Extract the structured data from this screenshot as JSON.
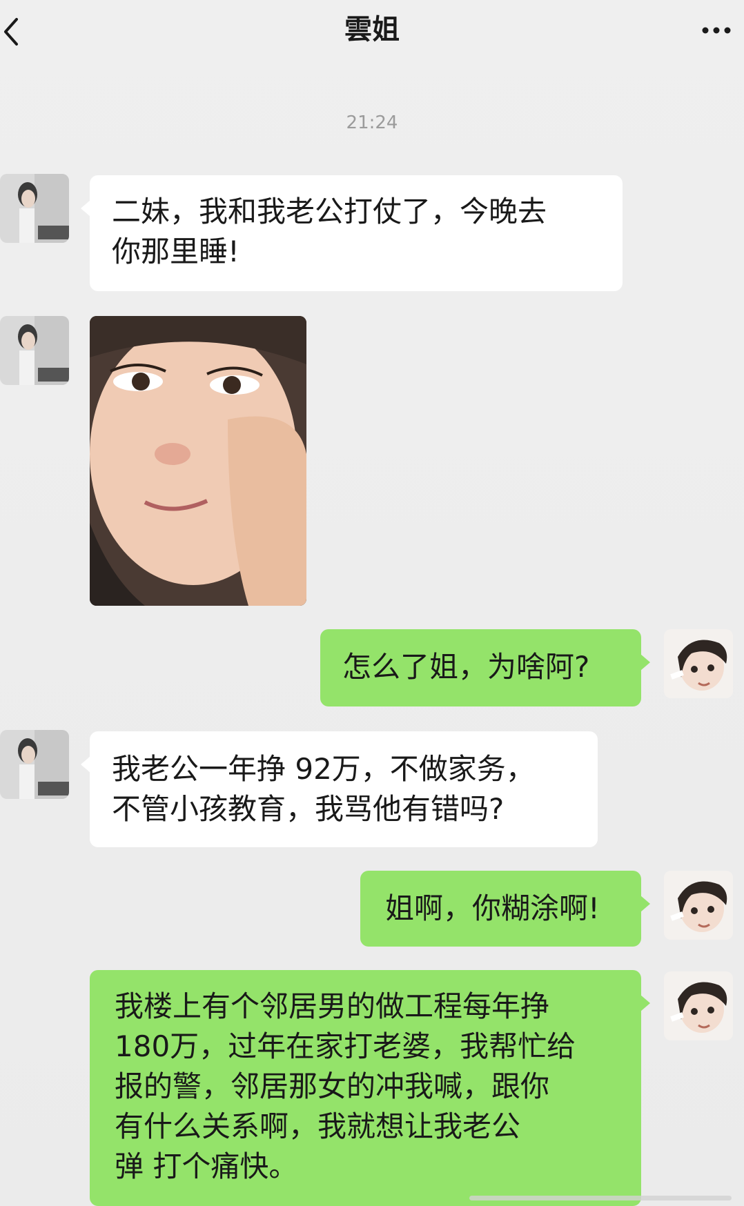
{
  "header": {
    "title": "雲姐"
  },
  "chat": {
    "timestamp": "21:24",
    "messages": [
      {
        "sender": "contact",
        "lines": [
          "二妹，我和我老公打仗了，今晚去",
          "你那里睡!"
        ]
      },
      {
        "sender": "contact",
        "type": "image"
      },
      {
        "sender": "me",
        "lines": [
          "怎么了姐，为啥阿?"
        ]
      },
      {
        "sender": "contact",
        "lines": [
          "我老公一年挣 92万，不做家务，",
          "不管小孩教育，我骂他有错吗?"
        ]
      },
      {
        "sender": "me",
        "lines": [
          "姐啊，你糊涂啊!"
        ]
      },
      {
        "sender": "me",
        "lines": [
          "我楼上有个邻居男的做工程每年挣",
          "180万，过年在家打老婆，我帮忙给",
          "报的警，邻居那女的冲我喊，跟你",
          "有什么关系啊，我就想让我老公",
          "弹 打个痛快。"
        ]
      }
    ]
  },
  "colors": {
    "background": "#ececec",
    "outgoing_bubble": "#94e36a",
    "incoming_bubble": "#ffffff",
    "timestamp_text": "#9b9b9b"
  },
  "icons": {
    "back": "chevron-left-icon",
    "more": "more-dots-icon"
  }
}
